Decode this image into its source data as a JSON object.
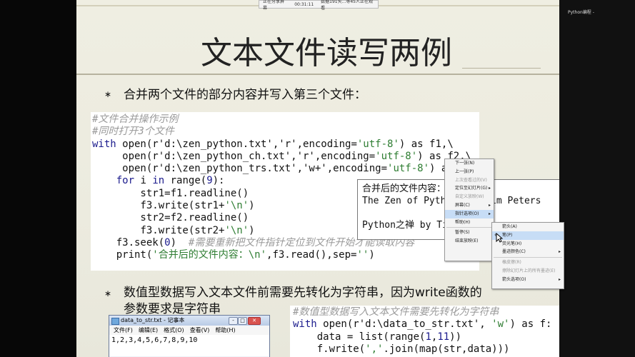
{
  "meeting_bar": {
    "sharing": "正在分享屏幕",
    "time": "00:31:11",
    "viewers": "数据191失...等45人正在观看"
  },
  "top_right": "Python编程 -",
  "slide": {
    "title": "文本文件读写两例",
    "bullet1": "合并两个文件的部分内容并写入第三个文件：",
    "bullet2_line1": "数值型数据写入文本文件前需要先转化为字符串，因为write函数的",
    "bullet2_line2": "参数要求是字符串",
    "bullet_char": "∗"
  },
  "code1": {
    "comment1": "#文件合并操作示例",
    "comment2": "#同时打开3个文件",
    "with": "with",
    "open1_a": " open(r'd:\\zen_python.txt','r',encoding=",
    "open1_s": "'utf-8'",
    "open1_b": ") as f1,\\",
    "open2_a": "     open(r'd:\\zen_python_ch.txt','r',encoding=",
    "open2_s": "'utf-8'",
    "open2_b": ") as f2,\\",
    "open3_a": "     open(r'd:\\zen_python_trs.txt','w+',encoding=",
    "open3_s": "'utf-8'",
    "open3_b": ") as f3:",
    "for_kw": "    for",
    "for_b": " i ",
    "in_kw": "in",
    "for_c": " range(",
    "for_n": "9",
    "for_d": "):",
    "l1": "        str1=f1.readline()",
    "l2_a": "        f3.write(str1+",
    "l2_s": "'\\n'",
    "l2_b": ")",
    "l3": "        str2=f2.readline()",
    "l4_a": "        f3.write(str2+",
    "l4_s": "'\\n'",
    "l4_b": ")",
    "seek_a": "    f3.seek(",
    "seek_n": "0",
    "seek_b": ")  ",
    "seek_c": "#需要重新把文件指针定位到文件开始才能读取内容",
    "print_a": "    print(",
    "print_s": "'合并后的文件内容：\\n'",
    "print_b": ",f3.read(),sep=",
    "print_s2": "''",
    "print_c": ")"
  },
  "output_box": {
    "l1": "合并后的文件内容：",
    "l2": "The Zen of Python, by Tim Peters",
    "l3": "",
    "l4": "Python之禅 by Tim Peters"
  },
  "context_menu": {
    "items": [
      "下一张(N)",
      "上一张(P)",
      "上次查看过的(V)",
      "定位至幻灯片(G)",
      "自定义放映(W)",
      "屏幕(C)",
      "指针选项(O)",
      "帮助(H)",
      "暂停(S)",
      "结束放映(E)"
    ]
  },
  "submenu": {
    "items": [
      "箭头(A)",
      "笔(P)",
      "荧光笔(H)",
      "墨迹颜色(C)",
      "橡皮擦(R)",
      "擦除幻灯片上的所有墨迹(E)",
      "箭头选项(O)"
    ]
  },
  "notepad": {
    "title": "data_to_str.txt - 记事本",
    "menu": [
      "文件(F)",
      "编辑(E)",
      "格式(O)",
      "查看(V)",
      "帮助(H)"
    ],
    "content": "1,2,3,4,5,6,7,8,9,10",
    "btn_min": "-",
    "btn_max": "□",
    "btn_close": "✕"
  },
  "code2": {
    "comment": "#数值型数据写入文本文件需要先转化为字符串",
    "with": "with",
    "l1_a": " open(r'd:\\data_to_str.txt', ",
    "l1_s": "'w'",
    "l1_b": ") as f:",
    "l2_a": "    data = list(range(",
    "l2_n1": "1",
    "l2_c": ",",
    "l2_n2": "11",
    "l2_b": "))",
    "l3_a": "    f.write(",
    "l3_s": "','",
    "l3_b": ".join(map(str,data)))"
  }
}
